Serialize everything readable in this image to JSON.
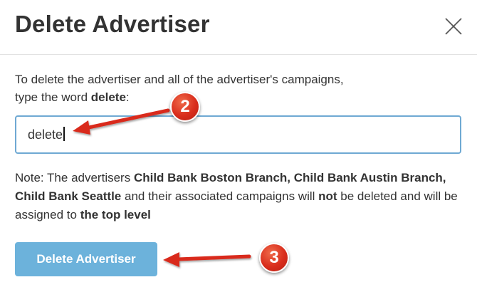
{
  "dialog": {
    "title": "Delete Advertiser",
    "close_icon": "close-icon",
    "instruction_line1": "To delete the advertiser and all of the advertiser's campaigns,",
    "instruction_line2_prefix": "type the word ",
    "instruction_keyword": "delete",
    "instruction_line2_suffix": ":",
    "confirm_input": {
      "value": "delete"
    },
    "note": {
      "prefix": "Note: The advertisers ",
      "advertisers": "Child Bank Boston Branch, Child Bank Austin Branch, Child Bank Seattle",
      "middle": " and their associated campaigns will ",
      "emphasis": "not",
      "middle2": " be deleted and will be assigned to ",
      "destination": "the top level"
    },
    "delete_button_label": "Delete Advertiser"
  },
  "annotations": {
    "step_2": "2",
    "step_3": "3",
    "arrow_color": "#d9291b",
    "accent_color": "#6cb2db",
    "input_border_color": "#6fa9d3"
  }
}
